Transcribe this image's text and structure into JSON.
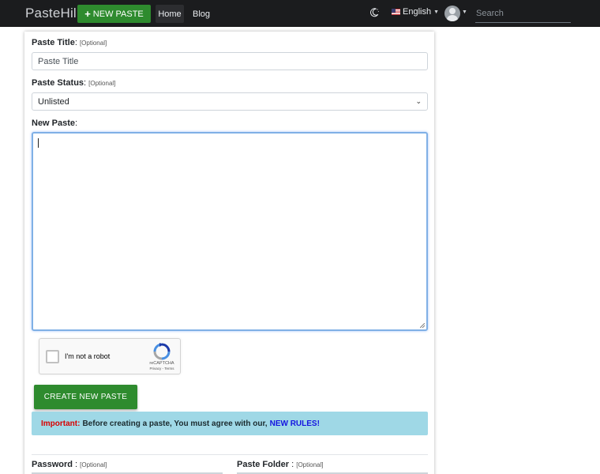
{
  "navbar": {
    "brand": "PasteHill",
    "new_paste": "NEW PASTE",
    "links": [
      "Home",
      "Blog"
    ],
    "language": "English",
    "search_placeholder": "Search",
    "theme_icon": "moon-icon",
    "flag_icon": "us-flag-icon",
    "avatar_icon": "user-avatar-icon"
  },
  "form": {
    "title_label": "Paste Title",
    "title_optional": "[Optional]",
    "title_placeholder": "Paste Title",
    "status_label": "Paste Status",
    "status_optional": "[Optional]",
    "status_value": "Unlisted",
    "paste_label": "New Paste",
    "paste_value": "",
    "captcha_text": "I'm not a robot",
    "captcha_brand": "reCAPTCHA",
    "captcha_terms": "Privacy - Terms",
    "create_button": "CREATE NEW PASTE",
    "alert_important": "Important:",
    "alert_text": "Before creating a paste, You must agree with our,",
    "alert_rules": "NEW RULES!",
    "password_label": "Password",
    "password_optional": "[Optional]",
    "folder_label": "Paste Folder",
    "folder_optional": "[Optional]"
  },
  "colors": {
    "navbar_bg": "#1b1c1e",
    "accent_green": "#2e8b2e",
    "alert_bg": "#9fd8e6",
    "important_red": "#d90000",
    "rules_blue": "#1515e0",
    "focus_border": "#80b0e6"
  }
}
